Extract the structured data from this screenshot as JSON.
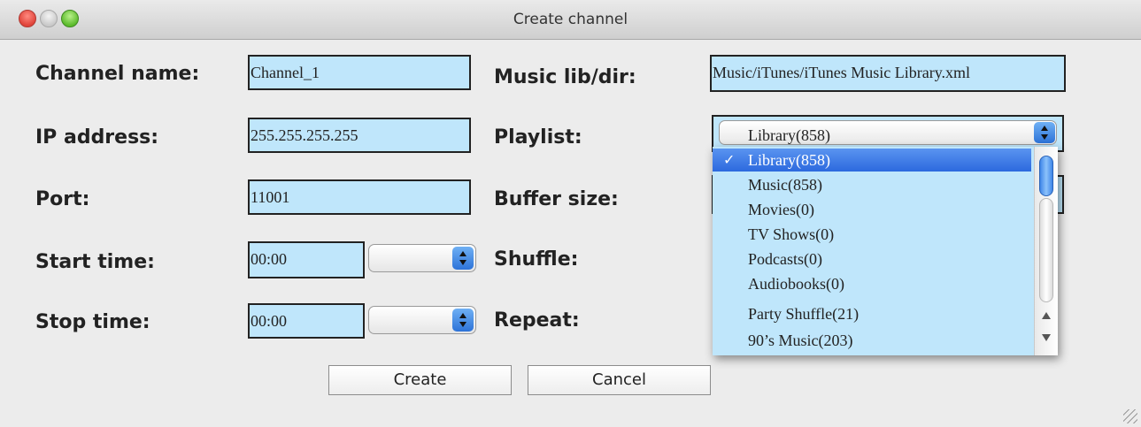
{
  "window": {
    "title": "Create channel"
  },
  "form": {
    "channel_name": {
      "label": "Channel name:",
      "value": "Channel_1"
    },
    "ip_address": {
      "label": "IP address:",
      "value": "255.255.255.255"
    },
    "port": {
      "label": "Port:",
      "value": "11001"
    },
    "start_time": {
      "label": "Start time:",
      "value": "00:00"
    },
    "stop_time": {
      "label": "Stop time:",
      "value": "00:00"
    },
    "music_lib": {
      "label": "Music lib/dir:",
      "value": "Music/iTunes/iTunes Music Library.xml"
    },
    "playlist": {
      "label": "Playlist:",
      "selected": "Library(858)"
    },
    "buffer_size": {
      "label": "Buffer size:"
    },
    "shuffle": {
      "label": "Shuffle:",
      "checked": false
    },
    "repeat": {
      "label": "Repeat:",
      "checked": false
    }
  },
  "playlist_menu": {
    "items": [
      "Library(858)",
      "Music(858)",
      "Movies(0)",
      "TV Shows(0)",
      "Podcasts(0)",
      "Audiobooks(0)",
      "Party Shuffle(21)",
      "90’s Music(203)"
    ],
    "selected_index": 0,
    "check_mark": "✓"
  },
  "buttons": {
    "create": "Create",
    "cancel": "Cancel"
  },
  "colors": {
    "field_bg": "#bfe6fb",
    "selection": "#2c69de",
    "window_bg": "#ececec"
  }
}
